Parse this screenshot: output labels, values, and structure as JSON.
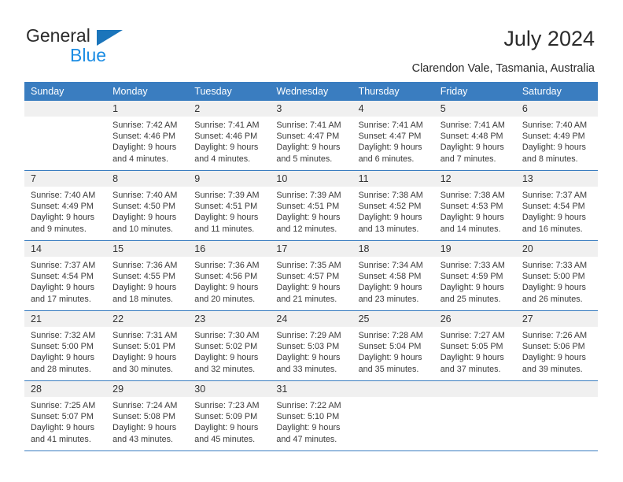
{
  "brand": {
    "name_top": "General",
    "name_bottom": "Blue",
    "accent_color": "#1b75bb",
    "blue_text_color": "#1b8ce3"
  },
  "header": {
    "title": "July 2024",
    "location": "Clarendon Vale, Tasmania, Australia",
    "header_bg_color": "#3a7dc0",
    "daynum_bg_color": "#f0f0f0"
  },
  "weekdays": [
    "Sunday",
    "Monday",
    "Tuesday",
    "Wednesday",
    "Thursday",
    "Friday",
    "Saturday"
  ],
  "labels": {
    "sunrise_prefix": "Sunrise:",
    "sunset_prefix": "Sunset:",
    "daylight_prefix": "Daylight:"
  },
  "weeks": [
    [
      {
        "day": "",
        "lines": []
      },
      {
        "day": "1",
        "lines": [
          "Sunrise: 7:42 AM",
          "Sunset: 4:46 PM",
          "Daylight: 9 hours",
          "and 4 minutes."
        ]
      },
      {
        "day": "2",
        "lines": [
          "Sunrise: 7:41 AM",
          "Sunset: 4:46 PM",
          "Daylight: 9 hours",
          "and 4 minutes."
        ]
      },
      {
        "day": "3",
        "lines": [
          "Sunrise: 7:41 AM",
          "Sunset: 4:47 PM",
          "Daylight: 9 hours",
          "and 5 minutes."
        ]
      },
      {
        "day": "4",
        "lines": [
          "Sunrise: 7:41 AM",
          "Sunset: 4:47 PM",
          "Daylight: 9 hours",
          "and 6 minutes."
        ]
      },
      {
        "day": "5",
        "lines": [
          "Sunrise: 7:41 AM",
          "Sunset: 4:48 PM",
          "Daylight: 9 hours",
          "and 7 minutes."
        ]
      },
      {
        "day": "6",
        "lines": [
          "Sunrise: 7:40 AM",
          "Sunset: 4:49 PM",
          "Daylight: 9 hours",
          "and 8 minutes."
        ]
      }
    ],
    [
      {
        "day": "7",
        "lines": [
          "Sunrise: 7:40 AM",
          "Sunset: 4:49 PM",
          "Daylight: 9 hours",
          "and 9 minutes."
        ]
      },
      {
        "day": "8",
        "lines": [
          "Sunrise: 7:40 AM",
          "Sunset: 4:50 PM",
          "Daylight: 9 hours",
          "and 10 minutes."
        ]
      },
      {
        "day": "9",
        "lines": [
          "Sunrise: 7:39 AM",
          "Sunset: 4:51 PM",
          "Daylight: 9 hours",
          "and 11 minutes."
        ]
      },
      {
        "day": "10",
        "lines": [
          "Sunrise: 7:39 AM",
          "Sunset: 4:51 PM",
          "Daylight: 9 hours",
          "and 12 minutes."
        ]
      },
      {
        "day": "11",
        "lines": [
          "Sunrise: 7:38 AM",
          "Sunset: 4:52 PM",
          "Daylight: 9 hours",
          "and 13 minutes."
        ]
      },
      {
        "day": "12",
        "lines": [
          "Sunrise: 7:38 AM",
          "Sunset: 4:53 PM",
          "Daylight: 9 hours",
          "and 14 minutes."
        ]
      },
      {
        "day": "13",
        "lines": [
          "Sunrise: 7:37 AM",
          "Sunset: 4:54 PM",
          "Daylight: 9 hours",
          "and 16 minutes."
        ]
      }
    ],
    [
      {
        "day": "14",
        "lines": [
          "Sunrise: 7:37 AM",
          "Sunset: 4:54 PM",
          "Daylight: 9 hours",
          "and 17 minutes."
        ]
      },
      {
        "day": "15",
        "lines": [
          "Sunrise: 7:36 AM",
          "Sunset: 4:55 PM",
          "Daylight: 9 hours",
          "and 18 minutes."
        ]
      },
      {
        "day": "16",
        "lines": [
          "Sunrise: 7:36 AM",
          "Sunset: 4:56 PM",
          "Daylight: 9 hours",
          "and 20 minutes."
        ]
      },
      {
        "day": "17",
        "lines": [
          "Sunrise: 7:35 AM",
          "Sunset: 4:57 PM",
          "Daylight: 9 hours",
          "and 21 minutes."
        ]
      },
      {
        "day": "18",
        "lines": [
          "Sunrise: 7:34 AM",
          "Sunset: 4:58 PM",
          "Daylight: 9 hours",
          "and 23 minutes."
        ]
      },
      {
        "day": "19",
        "lines": [
          "Sunrise: 7:33 AM",
          "Sunset: 4:59 PM",
          "Daylight: 9 hours",
          "and 25 minutes."
        ]
      },
      {
        "day": "20",
        "lines": [
          "Sunrise: 7:33 AM",
          "Sunset: 5:00 PM",
          "Daylight: 9 hours",
          "and 26 minutes."
        ]
      }
    ],
    [
      {
        "day": "21",
        "lines": [
          "Sunrise: 7:32 AM",
          "Sunset: 5:00 PM",
          "Daylight: 9 hours",
          "and 28 minutes."
        ]
      },
      {
        "day": "22",
        "lines": [
          "Sunrise: 7:31 AM",
          "Sunset: 5:01 PM",
          "Daylight: 9 hours",
          "and 30 minutes."
        ]
      },
      {
        "day": "23",
        "lines": [
          "Sunrise: 7:30 AM",
          "Sunset: 5:02 PM",
          "Daylight: 9 hours",
          "and 32 minutes."
        ]
      },
      {
        "day": "24",
        "lines": [
          "Sunrise: 7:29 AM",
          "Sunset: 5:03 PM",
          "Daylight: 9 hours",
          "and 33 minutes."
        ]
      },
      {
        "day": "25",
        "lines": [
          "Sunrise: 7:28 AM",
          "Sunset: 5:04 PM",
          "Daylight: 9 hours",
          "and 35 minutes."
        ]
      },
      {
        "day": "26",
        "lines": [
          "Sunrise: 7:27 AM",
          "Sunset: 5:05 PM",
          "Daylight: 9 hours",
          "and 37 minutes."
        ]
      },
      {
        "day": "27",
        "lines": [
          "Sunrise: 7:26 AM",
          "Sunset: 5:06 PM",
          "Daylight: 9 hours",
          "and 39 minutes."
        ]
      }
    ],
    [
      {
        "day": "28",
        "lines": [
          "Sunrise: 7:25 AM",
          "Sunset: 5:07 PM",
          "Daylight: 9 hours",
          "and 41 minutes."
        ]
      },
      {
        "day": "29",
        "lines": [
          "Sunrise: 7:24 AM",
          "Sunset: 5:08 PM",
          "Daylight: 9 hours",
          "and 43 minutes."
        ]
      },
      {
        "day": "30",
        "lines": [
          "Sunrise: 7:23 AM",
          "Sunset: 5:09 PM",
          "Daylight: 9 hours",
          "and 45 minutes."
        ]
      },
      {
        "day": "31",
        "lines": [
          "Sunrise: 7:22 AM",
          "Sunset: 5:10 PM",
          "Daylight: 9 hours",
          "and 47 minutes."
        ]
      },
      {
        "day": "",
        "lines": []
      },
      {
        "day": "",
        "lines": []
      },
      {
        "day": "",
        "lines": []
      }
    ]
  ]
}
